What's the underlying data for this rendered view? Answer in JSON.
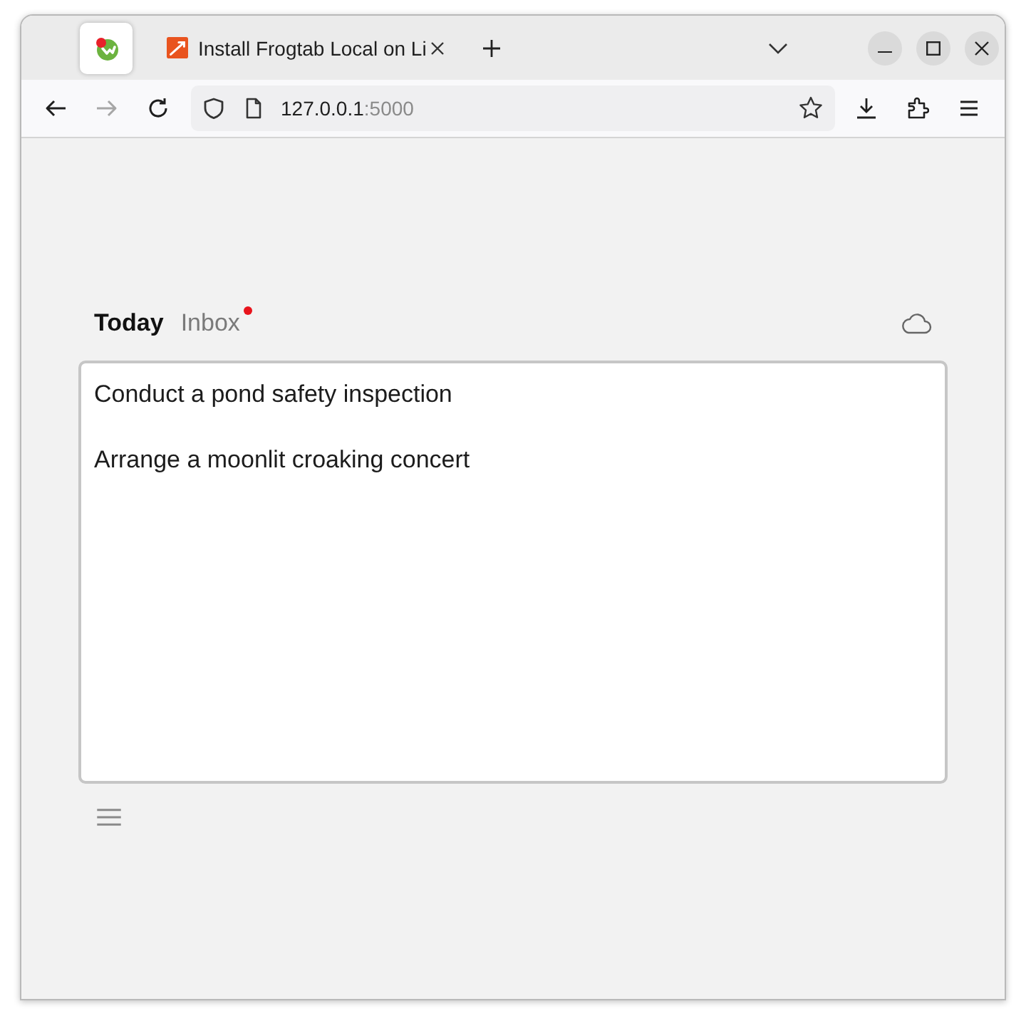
{
  "browser": {
    "tabs": [
      {
        "kind": "pinned",
        "selected": true
      },
      {
        "kind": "normal",
        "title": "Install Frogtab Local on Li",
        "selected": false
      }
    ],
    "navigation": {
      "back_disabled": false,
      "forward_disabled": true
    },
    "address": {
      "host": "127.0.0.1",
      "port": ":5000"
    }
  },
  "app": {
    "views": [
      {
        "label": "Today",
        "selected": true,
        "badge": false
      },
      {
        "label": "Inbox",
        "selected": false,
        "badge": true
      }
    ],
    "tasks": [
      "Conduct a pond safety inspection",
      "Arrange a moonlit croaking concert"
    ]
  }
}
